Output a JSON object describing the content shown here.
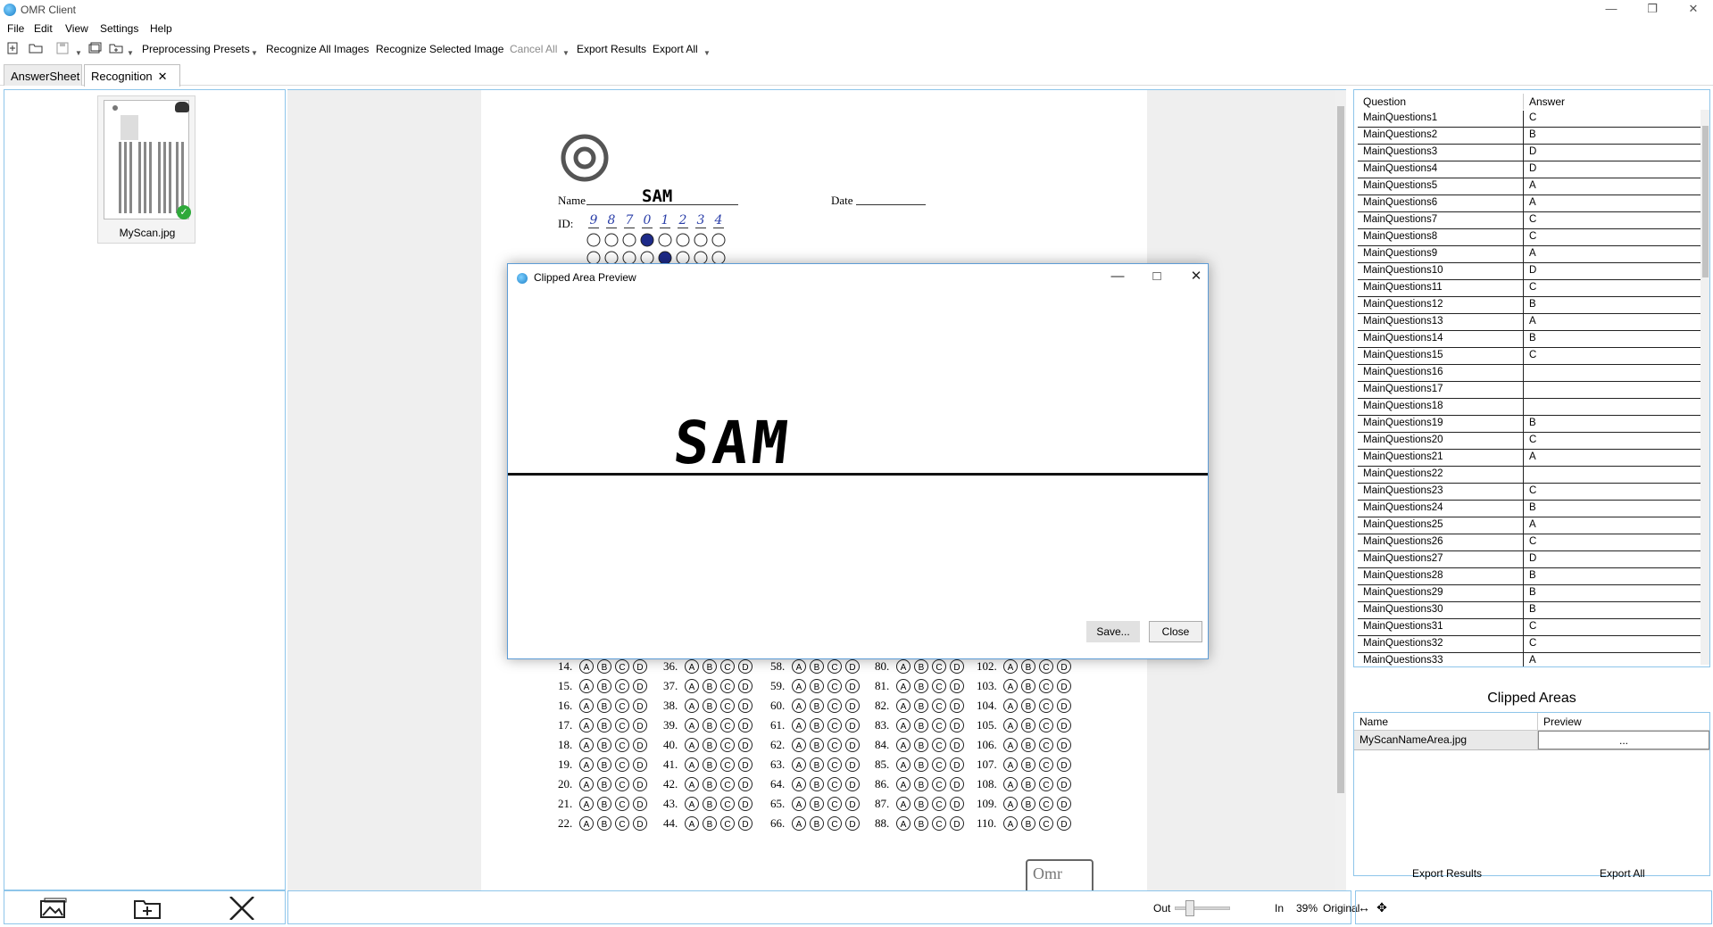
{
  "window": {
    "title": "OMR Client"
  },
  "menu": [
    "File",
    "Edit",
    "View",
    "Settings",
    "Help"
  ],
  "toolbar": {
    "preprocessing_presets": "Preprocessing Presets",
    "recognize_all": "Recognize All Images",
    "recognize_selected": "Recognize Selected Image",
    "cancel_all": "Cancel All",
    "export_results": "Export Results",
    "export_all": "Export All"
  },
  "tabs": [
    {
      "label": "AnswerSheet"
    },
    {
      "label": "Recognition"
    }
  ],
  "thumbnail": {
    "filename": "MyScan.jpg"
  },
  "answers": {
    "col_question": "Question",
    "col_answer": "Answer",
    "rows": [
      {
        "q": "MainQuestions1",
        "a": "C"
      },
      {
        "q": "MainQuestions2",
        "a": "B"
      },
      {
        "q": "MainQuestions3",
        "a": "D"
      },
      {
        "q": "MainQuestions4",
        "a": "D"
      },
      {
        "q": "MainQuestions5",
        "a": "A"
      },
      {
        "q": "MainQuestions6",
        "a": "A"
      },
      {
        "q": "MainQuestions7",
        "a": "C"
      },
      {
        "q": "MainQuestions8",
        "a": "C"
      },
      {
        "q": "MainQuestions9",
        "a": "A"
      },
      {
        "q": "MainQuestions10",
        "a": "D"
      },
      {
        "q": "MainQuestions11",
        "a": "C"
      },
      {
        "q": "MainQuestions12",
        "a": "B"
      },
      {
        "q": "MainQuestions13",
        "a": "A"
      },
      {
        "q": "MainQuestions14",
        "a": "B"
      },
      {
        "q": "MainQuestions15",
        "a": "C"
      },
      {
        "q": "MainQuestions16",
        "a": ""
      },
      {
        "q": "MainQuestions17",
        "a": ""
      },
      {
        "q": "MainQuestions18",
        "a": ""
      },
      {
        "q": "MainQuestions19",
        "a": "B"
      },
      {
        "q": "MainQuestions20",
        "a": "C"
      },
      {
        "q": "MainQuestions21",
        "a": "A"
      },
      {
        "q": "MainQuestions22",
        "a": ""
      },
      {
        "q": "MainQuestions23",
        "a": "C"
      },
      {
        "q": "MainQuestions24",
        "a": "B"
      },
      {
        "q": "MainQuestions25",
        "a": "A"
      },
      {
        "q": "MainQuestions26",
        "a": "C"
      },
      {
        "q": "MainQuestions27",
        "a": "D"
      },
      {
        "q": "MainQuestions28",
        "a": "B"
      },
      {
        "q": "MainQuestions29",
        "a": "B"
      },
      {
        "q": "MainQuestions30",
        "a": "B"
      },
      {
        "q": "MainQuestions31",
        "a": "C"
      },
      {
        "q": "MainQuestions32",
        "a": "C"
      },
      {
        "q": "MainQuestions33",
        "a": "A"
      }
    ]
  },
  "clipped": {
    "title": "Clipped Areas",
    "col_name": "Name",
    "col_preview": "Preview",
    "row_name": "MyScanNameArea.jpg",
    "row_preview": "..."
  },
  "right_buttons": {
    "export_results": "Export Results",
    "export_all": "Export All"
  },
  "zoom": {
    "out": "Out",
    "in": "In",
    "percent": "39%",
    "original": "Original",
    "value": 0.39
  },
  "sheet": {
    "name_label": "Name",
    "name_value": "SAM",
    "date_label": "Date",
    "id_label": "ID:",
    "id_digits": [
      "9",
      "8",
      "7",
      "0",
      "1",
      "2",
      "3",
      "4"
    ],
    "omr_mark": "Omr",
    "questions": [
      [
        14,
        36,
        58,
        80,
        102
      ],
      [
        15,
        37,
        59,
        81,
        103
      ],
      [
        16,
        38,
        60,
        82,
        104
      ],
      [
        17,
        39,
        61,
        83,
        105
      ],
      [
        18,
        40,
        62,
        84,
        106
      ],
      [
        19,
        41,
        63,
        85,
        107
      ],
      [
        20,
        42,
        64,
        86,
        108
      ],
      [
        21,
        43,
        65,
        87,
        109
      ],
      [
        22,
        44,
        66,
        88,
        110
      ]
    ]
  },
  "dialog": {
    "title": "Clipped Area Preview",
    "preview_text": "SAM",
    "save": "Save...",
    "close": "Close"
  }
}
